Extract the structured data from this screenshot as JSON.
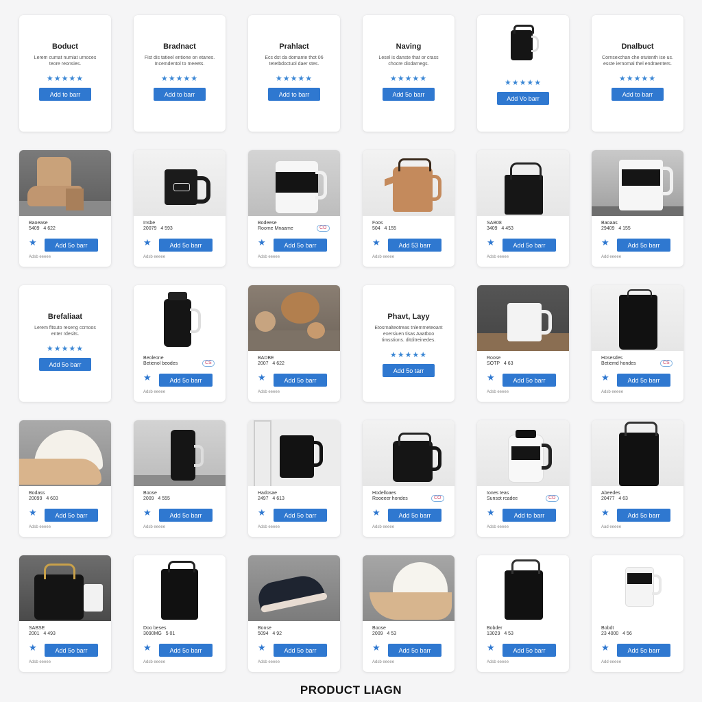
{
  "footer": {
    "title": "PRODUCT LIAGN"
  },
  "icons": {
    "star": "star-icon",
    "button": "add-to-cart"
  },
  "colors": {
    "accent": "#2f78d0",
    "star": "#3a86d4",
    "card": "#ffffff",
    "background": "#f5f5f6"
  },
  "cards": [
    {
      "kind": "text",
      "title": "Boduct",
      "desc": "Lerem cumat numiat urnoces teore reonsies.",
      "stars": "★★★★★",
      "button": "Add to barr"
    },
    {
      "kind": "text",
      "title": "Bradnact",
      "desc": "Fist dis tatieel entione on etanes. Incemdentol to meeets.",
      "stars": "★★★★★",
      "button": "Add to barr"
    },
    {
      "kind": "text",
      "title": "Prahlact",
      "desc": "Ecs dst da domante thot 06 tetetbdoctuol daer stes.",
      "stars": "★★★★★",
      "button": "Add to barr"
    },
    {
      "kind": "text",
      "title": "Naving",
      "desc": "Lesel is danste that or crass chocre dixdarnegs.",
      "stars": "★★★★★",
      "button": "Add 5o barr"
    },
    {
      "kind": "text-img",
      "title": "",
      "desc": "",
      "stars": "★★★★★",
      "button": "Add Vo barr"
    },
    {
      "kind": "text",
      "title": "Dnalbuct",
      "desc": "Cornsexchan che otutenth ise us. esste iernomal thel endraenters.",
      "stars": "★★★★★",
      "button": "Add to barr"
    },
    {
      "kind": "product",
      "img": "boot",
      "name": "Baoease",
      "price": "5409",
      "sub": "4 622",
      "badge": "",
      "button": "Add 5o barr",
      "link": "Adsb eeeee"
    },
    {
      "kind": "product",
      "img": "mug-black",
      "name": "Insbe",
      "price": "20079",
      "sub": "4 593",
      "badge": "",
      "button": "Add 5o barr",
      "link": "Adsb eeeee"
    },
    {
      "kind": "product",
      "img": "jug-white",
      "name": "Bodeese",
      "price": "Roome Mnaame",
      "sub": "",
      "badge": "CO",
      "button": "Add 5o barr",
      "link": "Adsb eeeee"
    },
    {
      "kind": "product",
      "img": "kettle-tan",
      "name": "Foos",
      "price": "504",
      "sub": "4 155",
      "badge": "",
      "button": "Add 53 barr",
      "link": "Adsb eeeee"
    },
    {
      "kind": "product",
      "img": "bag-black",
      "name": "SAB08",
      "price": "3409",
      "sub": "4 453",
      "badge": "",
      "button": "Add 5o barr",
      "link": "Adsb eeeee"
    },
    {
      "kind": "product",
      "img": "mug-white",
      "name": "Baoaas",
      "price": "29409",
      "sub": "4 155",
      "badge": "",
      "button": "Add 5o barr",
      "link": "Add eeeee"
    },
    {
      "kind": "text",
      "title": "Brefaliaat",
      "desc": "Lerem fltsuto reseng ccmoos enter rdesits.",
      "stars": "★★★★★",
      "button": "Add 5o barr"
    },
    {
      "kind": "product",
      "img": "bottle-black",
      "name": "Beoleone",
      "price": "Betienol beodes",
      "sub": "",
      "badge": "CS",
      "button": "Add 5o barr",
      "link": "Adsb eeeee"
    },
    {
      "kind": "product",
      "img": "wood",
      "name": "BADBE",
      "price": "2007",
      "sub": "4 622",
      "badge": "",
      "button": "Add 5o barr",
      "link": "Adsb eeeee"
    },
    {
      "kind": "text",
      "title": "Phavt, Layy",
      "desc": "Etosrnalteotreas tnlemmeteoant exersiuen tisas Aaatboo timsstions. ditditreinedes.",
      "stars": "★★★★★",
      "button": "Add 5o tarr"
    },
    {
      "kind": "product",
      "img": "mug-white-table",
      "name": "Roose",
      "price": "SOTP",
      "sub": "4 63",
      "badge": "",
      "button": "Add 5o barr",
      "link": "Adsb eeeee"
    },
    {
      "kind": "product",
      "img": "apron-black",
      "name": "Hosesdes",
      "price": "Betiemd hondes",
      "sub": "",
      "badge": "CS",
      "button": "Add 5o barr",
      "link": "Adsb eeeee"
    },
    {
      "kind": "product",
      "img": "cap",
      "name": "Bodass",
      "price": "20099",
      "sub": "4 603",
      "badge": "",
      "button": "Add 5o barr",
      "link": "Adsb eeeee"
    },
    {
      "kind": "product",
      "img": "tumbler",
      "name": "Boose",
      "price": "2009",
      "sub": "4 555",
      "badge": "",
      "button": "Add 5o barr",
      "link": "Adsb eeeee"
    },
    {
      "kind": "product",
      "img": "jug-window",
      "name": "Hadosae",
      "price": "2497",
      "sub": "4 613",
      "badge": "",
      "button": "Add 5o barr",
      "link": "Adsb eeeee"
    },
    {
      "kind": "product",
      "img": "kettle-black",
      "name": "Hodelloaes",
      "price": "Rooeeer hondes",
      "sub": "",
      "badge": "CO",
      "button": "Add 5o barr",
      "link": "Adsb eeeee"
    },
    {
      "kind": "product",
      "img": "jar-white",
      "name": "Iones teas",
      "price": "Sunsot rcadee",
      "sub": "",
      "badge": "CO",
      "button": "Add to barr",
      "link": "Adsb eeeee"
    },
    {
      "kind": "product",
      "img": "apron-tall",
      "name": "Abeedes",
      "price": "20477",
      "sub": "4 63",
      "badge": "",
      "button": "Add 5o barr",
      "link": "Aad eeeee"
    },
    {
      "kind": "product",
      "img": "bag-mug",
      "name": "SABSE",
      "price": "2001",
      "sub": "4 493",
      "badge": "",
      "button": "Add 5o barr",
      "link": "Adsb eeeee"
    },
    {
      "kind": "product",
      "img": "apron-small",
      "name": "Doo beses",
      "price": "3090MG",
      "sub": "5 01",
      "badge": "",
      "button": "Add 5o barr",
      "link": "Adsb eeeee"
    },
    {
      "kind": "product",
      "img": "shoe",
      "name": "Bonse",
      "price": "5094",
      "sub": "4 92",
      "badge": "",
      "button": "Add 5o barr",
      "link": "Adsb eeeee"
    },
    {
      "kind": "product",
      "img": "cap2",
      "name": "Boose",
      "price": "2009",
      "sub": "4 53",
      "badge": "",
      "button": "Add 5o barr",
      "link": "Adsb eeeee"
    },
    {
      "kind": "product",
      "img": "apron-bag",
      "name": "Bobder",
      "price": "13029",
      "sub": "4 53",
      "badge": "",
      "button": "Add 5o barr",
      "link": "Adsb eeeee"
    },
    {
      "kind": "product",
      "img": "mug-small",
      "name": "Bobdt",
      "price": "23 4000",
      "sub": "4 56",
      "badge": "",
      "button": "Add 5o barr",
      "link": "Add eeeee"
    }
  ]
}
